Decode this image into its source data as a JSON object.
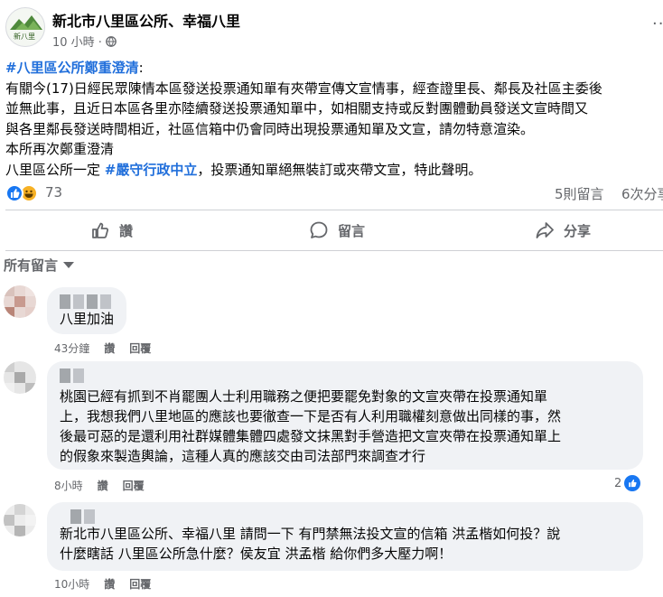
{
  "post": {
    "page_name": "新北市八里區公所、幸福八里",
    "time": "10 小時 ·",
    "body_lines": [
      [
        "#八里區公所鄭重澄清",
        ":"
      ],
      "有關今(17)日經民眾陳情本區發送投票通知單有夾帶宣傳文宣情事，經查證里長、鄰長及社區主委後",
      "並無此事，且近日本區各里亦陸續發送投票通知單中，如相關支持或反對團體動員發送文宣時間又",
      "與各里鄰長發送時間相近，社區信箱中仍會同時出現投票通知單及文宣，請勿特意渲染。",
      "本所再次鄭重澄清",
      [
        "八里區公所一定 ",
        "#嚴守行政中立",
        "，投票通知單絕無裝訂或夾帶文宣，特此聲明。"
      ]
    ]
  },
  "reactions": {
    "count": "73",
    "comments_count": "5則留言",
    "shares_count": "6次分享"
  },
  "actions": {
    "like": "讚",
    "comment": "留言",
    "share": "分享"
  },
  "sort": {
    "label": "所有留言"
  },
  "comments": [
    {
      "lines": [
        "八里加油"
      ],
      "time": "43分鐘",
      "like": "讚",
      "reply": "回覆"
    },
    {
      "lines": [
        "桃園已經有抓到不肖罷團人士利用職務之便把要罷免對象的文宣夾帶在投票通知單",
        "上，我想我們八里地區的應該也要徹查一下是否有人利用職權刻意做出同樣的事，然",
        "後最可惡的是還利用社群媒體集體四處發文抹黑對手營造把文宣夾帶在投票通知單上",
        "的假象來製造輿論，這種人真的應該交由司法部門來調查才行"
      ],
      "time": "8小時",
      "like": "讚",
      "reply": "回覆",
      "reaction_count": "2"
    },
    {
      "lines": [
        "新北市八里區公所、幸福八里  請問一下 有門禁無法投文宣的信箱 洪孟楷如何投？說",
        "什麼瞎話 八里區公所急什麼？侯友宜 洪孟楷 給你們多大壓力啊！"
      ],
      "time": "10小時",
      "like": "讚",
      "reply": "回覆"
    }
  ],
  "colors": {
    "hashtag": "#216fdb",
    "secondary_text": "#65676b",
    "bubble": "#f0f2f5",
    "like_blue": "#1877f2"
  },
  "icons": [
    "globe-icon",
    "more-icon",
    "like-reaction-icon",
    "haha-reaction-icon",
    "thumbs-up-icon",
    "comment-icon",
    "share-icon",
    "caret-down-icon"
  ]
}
